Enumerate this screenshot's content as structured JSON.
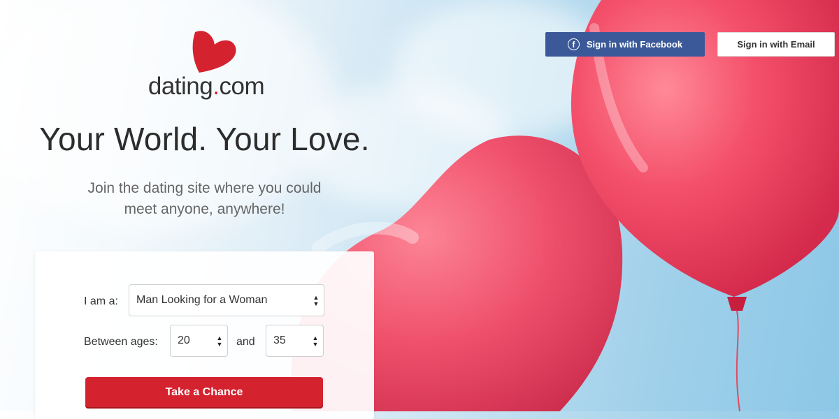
{
  "brand": {
    "name_prefix": "dating",
    "name_dot": ".",
    "name_suffix": "com",
    "accent_color": "#d4222e",
    "logo_icon": "heart-icon"
  },
  "header": {
    "facebook_label": "Sign in with Facebook",
    "facebook_icon": "facebook-icon",
    "facebook_icon_glyph": "f",
    "email_label": "Sign in with Email"
  },
  "hero": {
    "headline": "Your World. Your Love.",
    "subhead_line1": "Join the dating site where you could",
    "subhead_line2": "meet anyone, anywhere!"
  },
  "form": {
    "iam_label": "I am a:",
    "iam_value": "Man Looking for a Woman",
    "ages_label": "Between ages:",
    "age_min": "20",
    "and_label": "and",
    "age_max": "35",
    "submit_label": "Take a Chance"
  },
  "colors": {
    "facebook_blue": "#3b5998",
    "balloon_pink": "#f04a64"
  }
}
